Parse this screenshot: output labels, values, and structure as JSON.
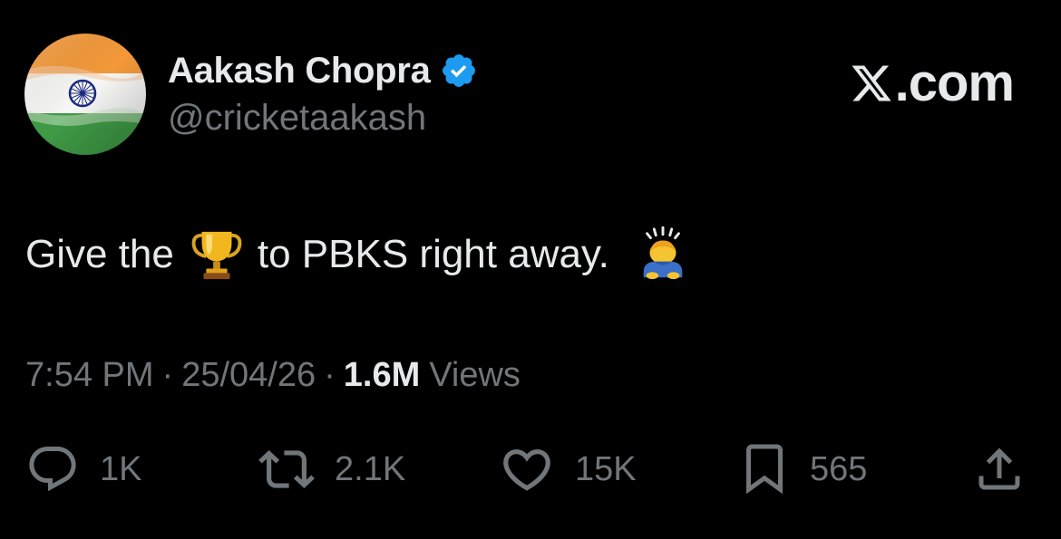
{
  "author": {
    "display_name": "Aakash Chopra",
    "handle": "@cricketaakash",
    "verified": true,
    "avatar_icon": "india-flag-avatar"
  },
  "brand": {
    "label": ".com",
    "icon": "x-logo-icon"
  },
  "tweet": {
    "text_before": "Give the",
    "emoji_1": "trophy-emoji",
    "text_middle": "to PBKS right away.",
    "emoji_2": "bowing-person-emoji"
  },
  "meta": {
    "time": "7:54 PM",
    "separator": "·",
    "date": "25/04/26",
    "views_count": "1.6M",
    "views_label": "Views"
  },
  "actions": {
    "reply_count": "1K",
    "retweet_count": "2.1K",
    "like_count": "15K",
    "bookmark_count": "565"
  },
  "colors": {
    "background": "#000000",
    "primary_text": "#e7e9ea",
    "secondary_text": "#71767b",
    "verified_blue": "#1d9bf0"
  }
}
